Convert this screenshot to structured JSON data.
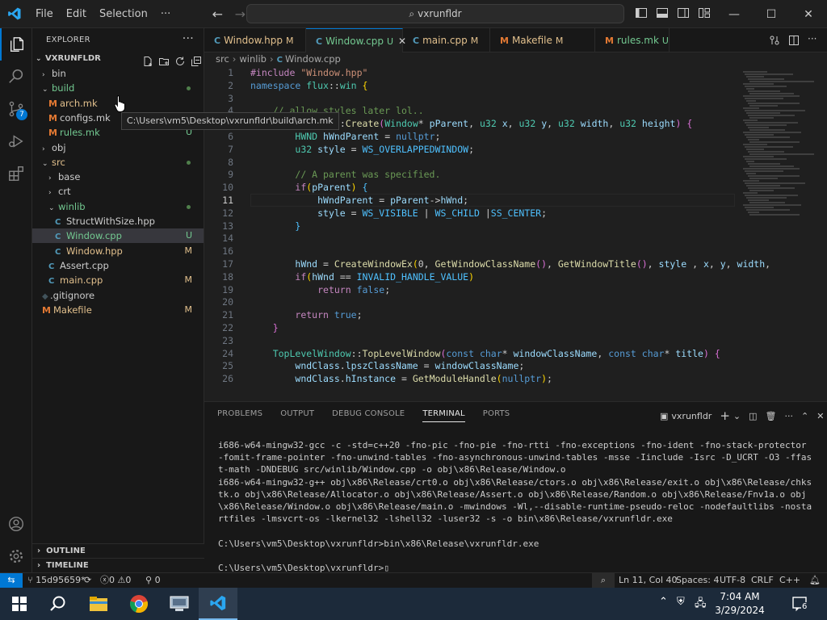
{
  "titlebar": {
    "menu": [
      "File",
      "Edit",
      "Selection"
    ],
    "more": "···",
    "search": "vxrunfldr"
  },
  "sidebar": {
    "header": "EXPLORER",
    "root": "VXRUNFLDR",
    "tree": [
      {
        "label": "bin",
        "kind": "folder",
        "open": false,
        "indent": 0
      },
      {
        "label": "build",
        "kind": "folder",
        "open": true,
        "indent": 0,
        "dot": true,
        "color": "#73c991"
      },
      {
        "label": "arch.mk",
        "kind": "mk",
        "indent": 1,
        "status": "",
        "color": "#e2c08d"
      },
      {
        "label": "configs.mk",
        "kind": "mk",
        "indent": 1,
        "status": "",
        "color": "#cccccc"
      },
      {
        "label": "rules.mk",
        "kind": "mk",
        "indent": 1,
        "status": "U",
        "color": "#73c991"
      },
      {
        "label": "obj",
        "kind": "folder",
        "open": false,
        "indent": 0
      },
      {
        "label": "src",
        "kind": "folder",
        "open": true,
        "indent": 0,
        "dot": true,
        "color": "#e2c08d"
      },
      {
        "label": "base",
        "kind": "folder",
        "open": false,
        "indent": 1
      },
      {
        "label": "crt",
        "kind": "folder",
        "open": false,
        "indent": 1
      },
      {
        "label": "winlib",
        "kind": "folder",
        "open": true,
        "indent": 1,
        "dot": true,
        "color": "#73c991"
      },
      {
        "label": "StructWithSize.hpp",
        "kind": "c",
        "indent": 2,
        "status": "",
        "color": "#cccccc"
      },
      {
        "label": "Window.cpp",
        "kind": "c",
        "indent": 2,
        "status": "U",
        "color": "#73c991",
        "selected": true
      },
      {
        "label": "Window.hpp",
        "kind": "c",
        "indent": 2,
        "status": "M",
        "color": "#e2c08d"
      },
      {
        "label": "Assert.cpp",
        "kind": "c",
        "indent": 1,
        "status": "",
        "color": "#cccccc"
      },
      {
        "label": "main.cpp",
        "kind": "c",
        "indent": 1,
        "status": "M",
        "color": "#e2c08d"
      },
      {
        "label": ".gitignore",
        "kind": "git",
        "indent": 0,
        "status": "",
        "color": "#cccccc"
      },
      {
        "label": "Makefile",
        "kind": "mk",
        "indent": 0,
        "status": "M",
        "color": "#e2c08d"
      }
    ],
    "tooltip": "C:\\Users\\vm5\\Desktop\\vxrunfldr\\build\\arch.mk",
    "outline": "OUTLINE",
    "timeline": "TIMELINE"
  },
  "tabs": [
    {
      "icon": "C",
      "label": "Window.hpp",
      "status": "M",
      "color": "#e2c08d"
    },
    {
      "icon": "C",
      "label": "Window.cpp",
      "status": "U",
      "color": "#73c991",
      "active": true
    },
    {
      "icon": "C",
      "label": "main.cpp",
      "status": "M",
      "color": "#e2c08d"
    },
    {
      "icon": "M",
      "label": "Makefile",
      "status": "M",
      "color": "#e2c08d"
    },
    {
      "icon": "M",
      "label": "rules.mk",
      "status": "U",
      "color": "#73c991"
    }
  ],
  "breadcrumbs": [
    "src",
    "winlib",
    "Window.cpp"
  ],
  "editor": {
    "current_line": 11,
    "lines": [
      {
        "n": "1",
        "html": "<span class=\"pp\">#include</span> <span class=\"st\">\"Window.hpp\"</span>"
      },
      {
        "n": "2",
        "html": "<span class=\"kw\">namespace</span> <span class=\"ty\">flux</span>::<span class=\"ty\">win</span> <span class=\"br\">{</span>"
      },
      {
        "n": "3",
        "html": ""
      },
      {
        "n": "4",
        "html": "    <span class=\"cm\">// allow styles later lol..</span>"
      },
      {
        "n": "5",
        "html": "    <span class=\"kw\">bool</span> <span class=\"ty\">Window</span>::<span class=\"fn\">Create</span><span class=\"br2\">(</span><span class=\"ty\">Window</span>* <span class=\"vr\">pParent</span>, <span class=\"ty\">u32</span> <span class=\"vr\">x</span>, <span class=\"ty\">u32</span> <span class=\"vr\">y</span>, <span class=\"ty\">u32</span> <span class=\"vr\">width</span>, <span class=\"ty\">u32</span> <span class=\"vr\">height</span><span class=\"br2\">)</span> <span class=\"br2\">{</span>"
      },
      {
        "n": "6",
        "html": "        <span class=\"ty\">HWND</span> <span class=\"vr\">hWndParent</span> = <span class=\"kw\">nullptr</span>;"
      },
      {
        "n": "7",
        "html": "        <span class=\"ty\">u32</span> <span class=\"vr\">style</span> = <span class=\"mc\">WS_OVERLAPPEDWINDOW</span>;"
      },
      {
        "n": "8",
        "html": ""
      },
      {
        "n": "9",
        "html": "        <span class=\"cm\">// A parent was specified.</span>"
      },
      {
        "n": "10",
        "html": "        <span class=\"pp\">if</span><span class=\"br\">(</span><span class=\"vr\">pParent</span><span class=\"br\">)</span> <span class=\"mc\">{</span>"
      },
      {
        "n": "11",
        "html": "            <span class=\"vr\">hWndParent</span> = <span class=\"vr\">pParent</span>-&gt;<span class=\"vr\">hWnd</span>;"
      },
      {
        "n": "12",
        "html": "            <span class=\"vr\">style</span> = <span class=\"mc\">WS_VISIBLE</span> | <span class=\"mc\">WS_CHILD</span> |<span class=\"mc\">SS_CENTER</span>;"
      },
      {
        "n": "13",
        "html": "        <span class=\"mc\">}</span>"
      },
      {
        "n": "14",
        "html": ""
      },
      {
        "n": "16",
        "html": ""
      },
      {
        "n": "17",
        "html": "        <span class=\"vr\">hWnd</span> = <span class=\"fn\">CreateWindowEx</span><span class=\"br\">(</span>0, <span class=\"fn\">GetWindowClassName</span><span class=\"br2\">()</span>, <span class=\"fn\">GetWindowTitle</span><span class=\"br2\">()</span>, <span class=\"vr\">style</span> , <span class=\"vr\">x</span>, <span class=\"vr\">y</span>, <span class=\"vr\">width</span>,"
      },
      {
        "n": "18",
        "html": "        <span class=\"pp\">if</span><span class=\"br\">(</span><span class=\"vr\">hWnd</span> == <span class=\"mc\">INVALID_HANDLE_VALUE</span><span class=\"br\">)</span>"
      },
      {
        "n": "19",
        "html": "            <span class=\"pp\">return</span> <span class=\"kw\">false</span>;"
      },
      {
        "n": "20",
        "html": ""
      },
      {
        "n": "21",
        "html": "        <span class=\"pp\">return</span> <span class=\"kw\">true</span>;"
      },
      {
        "n": "22",
        "html": "    <span class=\"br2\">}</span>"
      },
      {
        "n": "23",
        "html": ""
      },
      {
        "n": "24",
        "html": "    <span class=\"ty\">TopLevelWindow</span>::<span class=\"fn\">TopLevelWindow</span><span class=\"br2\">(</span><span class=\"kw\">const</span> <span class=\"kw\">char</span>* <span class=\"vr\">windowClassName</span>, <span class=\"kw\">const</span> <span class=\"kw\">char</span>* <span class=\"vr\">title</span><span class=\"br2\">)</span> <span class=\"br2\">{</span>"
      },
      {
        "n": "25",
        "html": "        <span class=\"vr\">wndClass</span>.<span class=\"vr\">lpszClassName</span> = <span class=\"vr\">windowClassName</span>;"
      },
      {
        "n": "26",
        "html": "        <span class=\"vr\">wndClass</span>.<span class=\"vr\">hInstance</span> = <span class=\"fn\">GetModuleHandle</span><span class=\"br\">(</span><span class=\"kw\">nullptr</span><span class=\"br\">)</span>;"
      }
    ]
  },
  "panel": {
    "tabs": [
      "PROBLEMS",
      "OUTPUT",
      "DEBUG CONSOLE",
      "TERMINAL",
      "PORTS"
    ],
    "active_tab": "TERMINAL",
    "terminal_name": "vxrunfldr",
    "terminal_lines": [
      "i686-w64-mingw32-gcc -c -std=c++20 -fno-pic -fno-pie -fno-rtti -fno-exceptions -fno-ident -fno-stack-protector -fomit-frame-pointer -fno-unwind-tables -fno-asynchronous-unwind-tables -msse -Iinclude -Isrc -D_UCRT -O3 -ffast-math -DNDEBUG src/winlib/Window.cpp -o obj\\x86\\Release/Window.o",
      "i686-w64-mingw32-g++ obj\\x86\\Release/crt0.o obj\\x86\\Release/ctors.o obj\\x86\\Release/exit.o obj\\x86\\Release/chkstk.o obj\\x86\\Release/Allocator.o obj\\x86\\Release/Assert.o obj\\x86\\Release/Random.o obj\\x86\\Release/Fnv1a.o obj\\x86\\Release/Window.o obj\\x86\\Release/main.o -mwindows -Wl,--disable-runtime-pseudo-reloc -nodefaultlibs -nostartfiles -lmsvcrt-os -lkernel32 -lshell32 -luser32 -s -o bin\\x86\\Release/vxrunfldr.exe",
      "",
      "C:\\Users\\vm5\\Desktop\\vxrunfldr>bin\\x86\\Release\\vxrunfldr.exe",
      "",
      "C:\\Users\\vm5\\Desktop\\vxrunfldr>"
    ]
  },
  "statusbar": {
    "branch": "15d95659*",
    "errors": "0",
    "warnings": "0",
    "ports": "0",
    "position": "Ln 11, Col 40",
    "spaces": "Spaces: 4",
    "encoding": "UTF-8",
    "eol": "CRLF",
    "language": "C++"
  },
  "taskbar": {
    "time": "7:04 AM",
    "date": "3/29/2024",
    "notifications": "6"
  },
  "activity_badge": "7",
  "colors": {
    "accent": "#0078d4",
    "modified": "#e2c08d",
    "untracked": "#73c991"
  }
}
